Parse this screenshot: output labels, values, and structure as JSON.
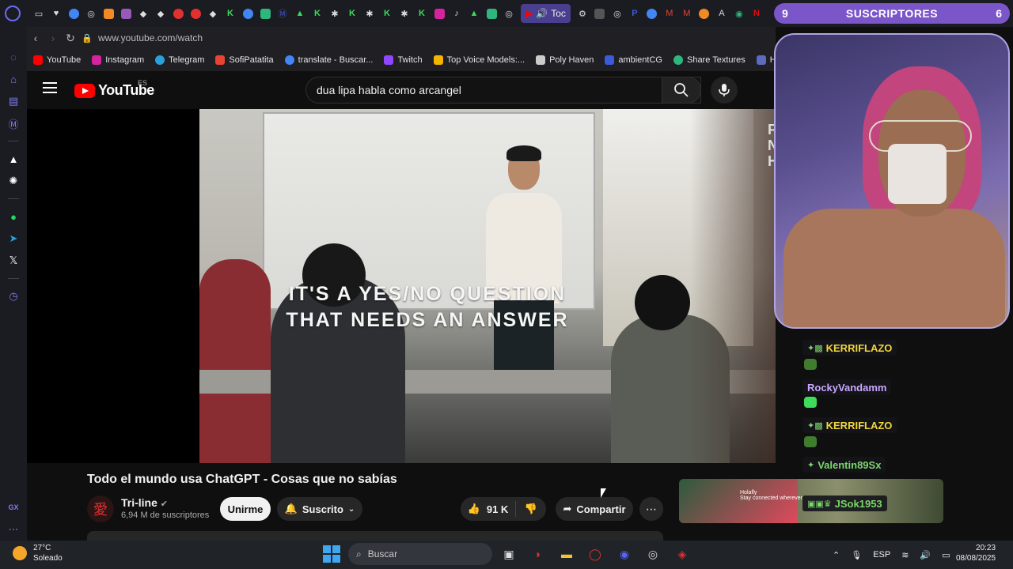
{
  "browser": {
    "active_tab_label": "Toc",
    "address_url": "www.youtube.com/watch",
    "bookmarks": [
      {
        "label": "YouTube",
        "color": "#ff0000"
      },
      {
        "label": "Instagram",
        "color": "#d6249f"
      },
      {
        "label": "Telegram",
        "color": "#2aa1da"
      },
      {
        "label": "SofiPatatita",
        "color": "#ea4335"
      },
      {
        "label": "translate - Buscar...",
        "color": "#4285f4"
      },
      {
        "label": "Twitch",
        "color": "#9146ff"
      },
      {
        "label": "Top Voice Models:...",
        "color": "#f4b400"
      },
      {
        "label": "Poly Haven",
        "color": "#cccccc"
      },
      {
        "label": "ambientCG",
        "color": "#3b5bdb"
      },
      {
        "label": "Share Textures",
        "color": "#2fb67c"
      },
      {
        "label": "Ha",
        "color": "#5c6bc0"
      }
    ]
  },
  "youtube": {
    "logo_text": "YouTube",
    "region": "ES",
    "search_query": "dua lipa habla como arcangel",
    "video": {
      "caption_line1": "IT'S A YES/NO QUESTION",
      "caption_line2": "THAT NEEDS AN ANSWER",
      "side_letters": "F\nN\nH"
    },
    "title": "Todo el mundo usa ChatGPT - Cosas que no sabías",
    "channel": {
      "name": "Tri-line",
      "subscribers": "6,94 M de suscriptores",
      "join_label": "Unirme",
      "subscribed_label": "Suscrito"
    },
    "likes": "91 K",
    "share_label": "Compartir"
  },
  "stream_overlay": {
    "subs_count_left": "9",
    "subs_label": "SUSCRIPTORES",
    "subs_count_right": "6",
    "chat": [
      {
        "user": "KERRIFLAZO",
        "color": "#f2d73a"
      },
      {
        "user": "RockyVandamm",
        "color": "#c9a8ff"
      },
      {
        "user": "KERRIFLAZO",
        "color": "#f2d73a"
      },
      {
        "user": "Valentin89Sx",
        "color": "#7bd66b"
      },
      {
        "user": "JSok1953",
        "color": "#7bd66b"
      }
    ],
    "reco_text_1": "Holafly",
    "reco_text_2": "Stay connected wherever"
  },
  "taskbar": {
    "temperature": "27°C",
    "weather": "Soleado",
    "search_placeholder": "Buscar",
    "language": "ESP",
    "time": "20:23",
    "date": "08/08/2025"
  }
}
